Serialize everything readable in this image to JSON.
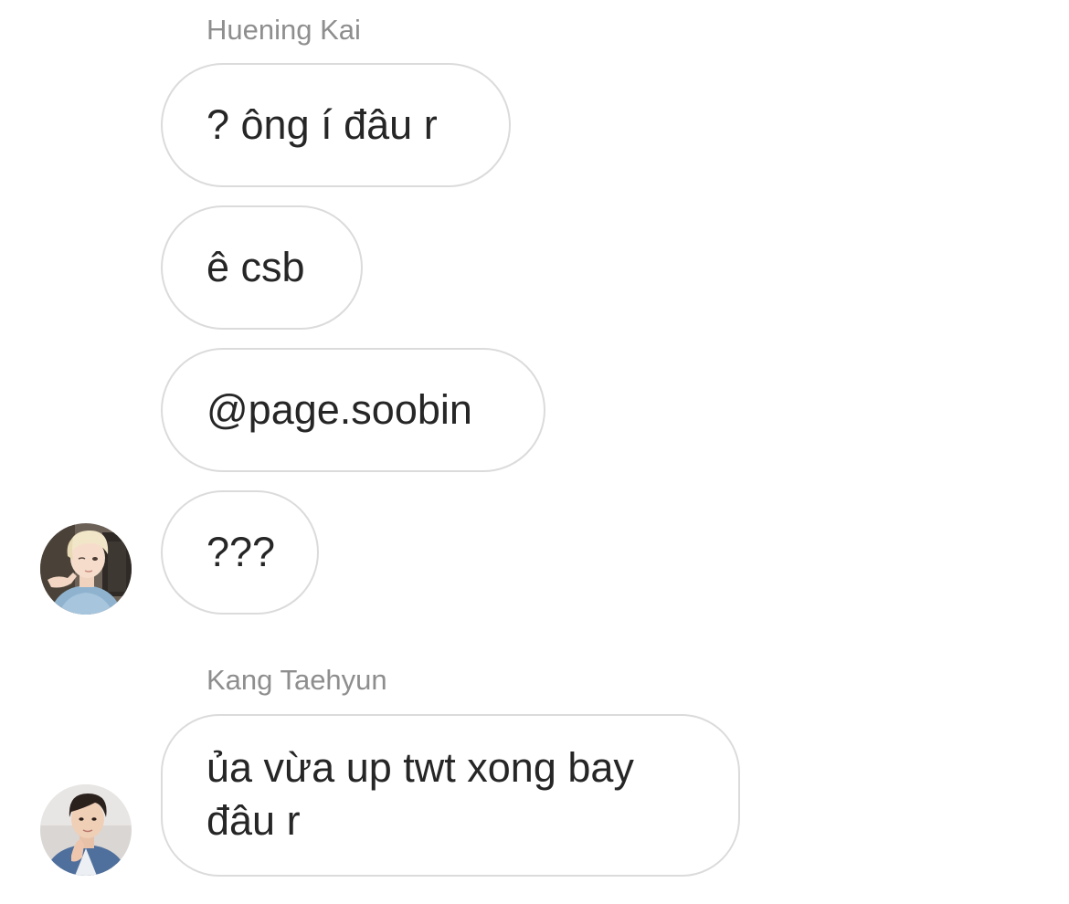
{
  "thread": {
    "groups": [
      {
        "sender": "Huening Kai",
        "avatar_icon": "profile-photo-blond-hair",
        "messages": [
          "? ông í đâu r",
          "ê csb",
          "@page.soobin",
          "???"
        ]
      },
      {
        "sender": "Kang Taehyun",
        "avatar_icon": "profile-photo-dark-hair",
        "messages": [
          "ủa vừa up twt xong bay đâu r"
        ]
      }
    ]
  },
  "colors": {
    "bubble_border": "#dbdbdb",
    "sender_name": "#8e8e8e",
    "message_text": "#262626",
    "background": "#ffffff"
  }
}
